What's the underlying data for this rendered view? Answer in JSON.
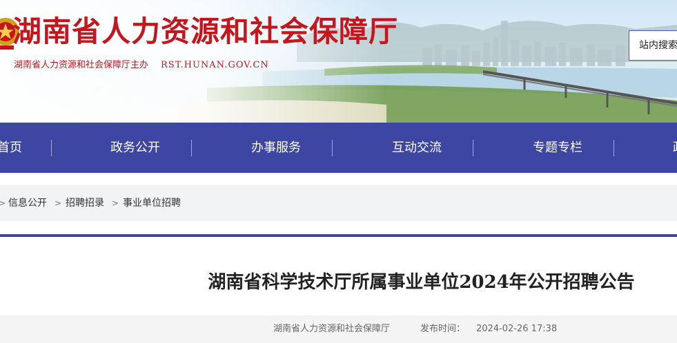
{
  "header": {
    "title": "湖南省人力资源和社会保障厅",
    "subtitle": "湖南省人力资源和社会保障厅主办",
    "domain": "RST.HUNAN.GOV.CN",
    "search_label": "站内搜索"
  },
  "nav": {
    "items": [
      "首页",
      "政务公开",
      "办事服务",
      "互动交流",
      "专题专栏",
      "政"
    ]
  },
  "breadcrumb": {
    "items": [
      "信息公开",
      "招聘招录",
      "事业单位招聘"
    ]
  },
  "article": {
    "title": "湖南省科学技术厅所属事业单位2024年公开招聘公告",
    "source": "湖南省人力资源和社会保障厅",
    "published_label": "发布时间：",
    "published_time": "2024-02-26 17:38"
  },
  "colors": {
    "brand_red": "#c4161c",
    "nav_blue": "#3d46a3",
    "crumb_bg": "#f2f3f5"
  }
}
